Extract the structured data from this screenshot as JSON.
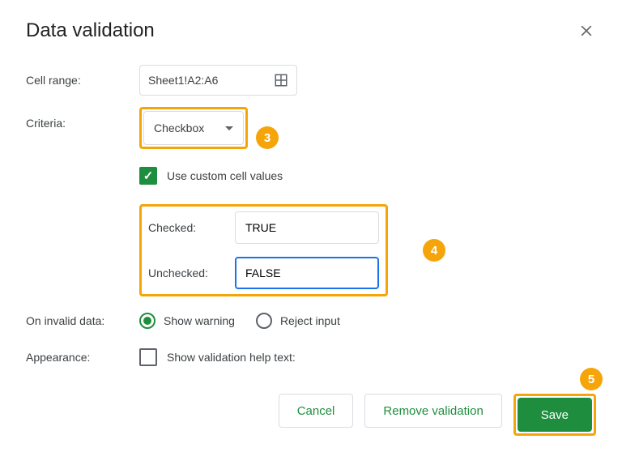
{
  "title": "Data validation",
  "labels": {
    "cell_range": "Cell range:",
    "criteria": "Criteria:",
    "on_invalid": "On invalid data:",
    "appearance": "Appearance:"
  },
  "cell_range_value": "Sheet1!A2:A6",
  "criteria": {
    "selected": "Checkbox"
  },
  "use_custom_values": {
    "label": "Use custom cell values",
    "checked": true
  },
  "custom_values": {
    "checked_label": "Checked:",
    "checked_value": "TRUE",
    "unchecked_label": "Unchecked:",
    "unchecked_value": "FALSE"
  },
  "invalid_data": {
    "show_warning": "Show warning",
    "reject_input": "Reject input"
  },
  "appearance_help_text": "Show validation help text:",
  "buttons": {
    "cancel": "Cancel",
    "remove": "Remove validation",
    "save": "Save"
  },
  "callouts": {
    "c3": "3",
    "c4": "4",
    "c5": "5"
  }
}
